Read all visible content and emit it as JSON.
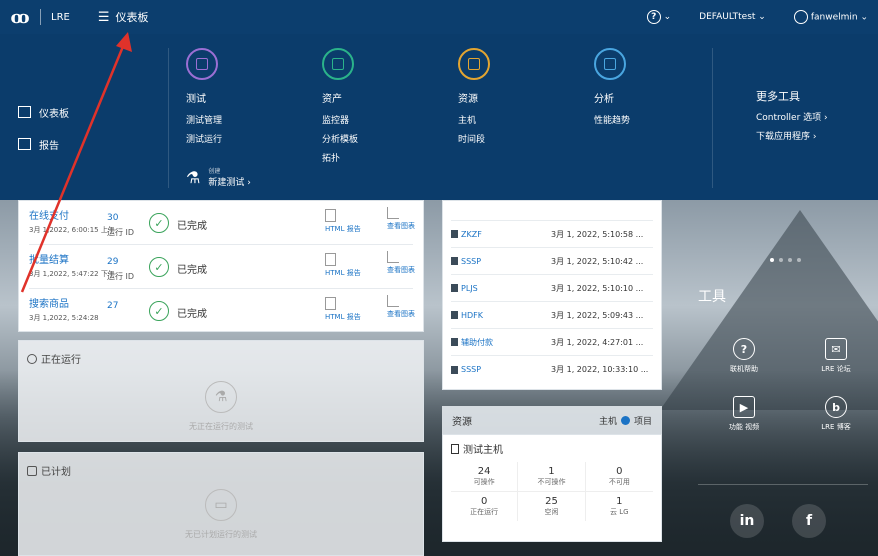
{
  "topbar": {
    "logo": "ꝏ",
    "app_name": "LRE",
    "menu_icon": "hamburger-icon",
    "title": "仪表板",
    "help_label": "?",
    "tenant": "DEFAULTtest",
    "user": "fanwelmin"
  },
  "mega_menu": {
    "left": [
      {
        "label": "仪表板",
        "icon": "grid-icon"
      },
      {
        "label": "报告",
        "icon": "report-icon"
      }
    ],
    "columns": [
      {
        "heading": "测试",
        "color": "#9b6fd4",
        "items": [
          "测试管理",
          "测试运行"
        ]
      },
      {
        "heading": "资产",
        "color": "#2bb38a",
        "items": [
          "监控器",
          "分析模板",
          "拓扑"
        ]
      },
      {
        "heading": "资源",
        "color": "#e3a531",
        "items": [
          "主机",
          "时间段"
        ]
      },
      {
        "heading": "分析",
        "color": "#4aa6e0",
        "items": [
          "性能趋势"
        ]
      }
    ],
    "new_test": {
      "small": "创建",
      "label": "新建测试 ›"
    },
    "more": {
      "heading": "更多工具",
      "items": [
        "Controller 选项 ›",
        "下载应用程序 ›"
      ]
    }
  },
  "runs": [
    {
      "name": "在线支付",
      "date": "3月 1,2022, 6:00:15 上午",
      "id": "30",
      "id_label": "运行 ID",
      "status": "已完成",
      "report": "HTML 报告",
      "chart": "查看图表"
    },
    {
      "name": "批量结算",
      "date": "3月 1,2022, 5:47:22 下午",
      "id": "29",
      "id_label": "运行 ID",
      "status": "已完成",
      "report": "HTML 报告",
      "chart": "查看图表"
    },
    {
      "name": "搜索商品",
      "date": "3月 1,2022, 5:24:28",
      "id": "27",
      "id_label": "",
      "status": "已完成",
      "report": "HTML 报告",
      "chart": "查看图表"
    }
  ],
  "running": {
    "title": "正在运行",
    "empty": "无正在运行的测试"
  },
  "planned": {
    "title": "已计划",
    "empty": "无已计划运行的测试"
  },
  "hosts": [
    {
      "name": "",
      "date": ""
    },
    {
      "name": "ZKZF",
      "date": "3月 1, 2022, 5:10:58 ..."
    },
    {
      "name": "SSSP",
      "date": "3月 1, 2022, 5:10:42 ..."
    },
    {
      "name": "PLJS",
      "date": "3月 1, 2022, 5:10:10 ..."
    },
    {
      "name": "HDFK",
      "date": "3月 1, 2022, 5:09:43 ..."
    },
    {
      "name": "辅助付款",
      "date": "3月 1, 2022, 4:27:01 ..."
    },
    {
      "name": "SSSP",
      "date": "3月 1, 2022, 10:33:10 ..."
    }
  ],
  "resources": {
    "title": "资源",
    "opt_host": "主机",
    "opt_project": "项目",
    "sub_title": "测试主机",
    "cells": [
      {
        "num": "24",
        "label": "可操作"
      },
      {
        "num": "1",
        "label": "不可操作"
      },
      {
        "num": "0",
        "label": "不可用"
      },
      {
        "num": "0",
        "label": "正在运行"
      },
      {
        "num": "25",
        "label": "空闲"
      },
      {
        "num": "1",
        "label": "云 LG"
      }
    ]
  },
  "tools": {
    "title": "工具",
    "items": [
      {
        "label": "联机帮助",
        "icon": "help-circle-icon",
        "glyph": "?"
      },
      {
        "label": "LRE 论坛",
        "icon": "chat-icon",
        "glyph": "✉"
      },
      {
        "label": "功能 视频",
        "icon": "video-icon",
        "glyph": "▶"
      },
      {
        "label": "LRE 博客",
        "icon": "blog-icon",
        "glyph": "b"
      }
    ]
  },
  "social": [
    "in",
    "f"
  ],
  "colors": {
    "header": "#0c3e6e",
    "link": "#1b73c5",
    "success": "#3aa35b",
    "annotation": "#e0322a"
  }
}
